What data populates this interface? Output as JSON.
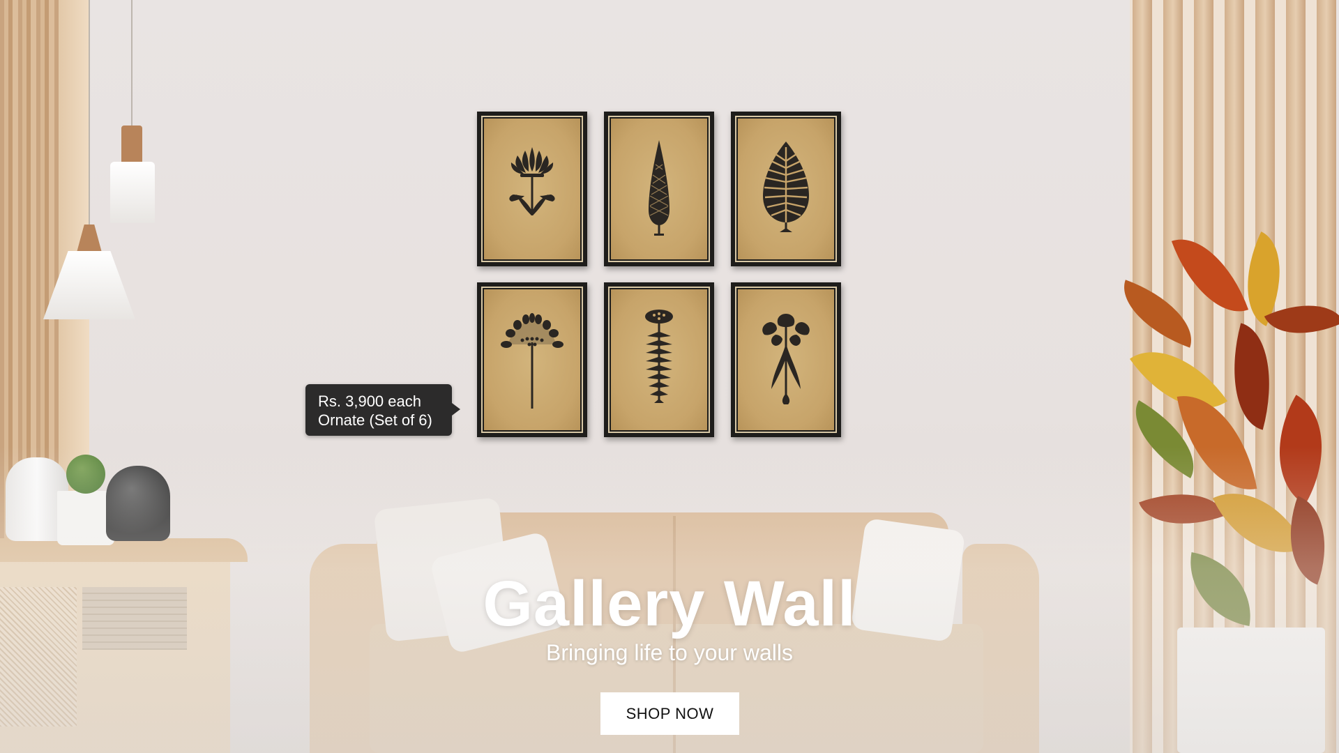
{
  "hero": {
    "title": "Gallery Wall",
    "subtitle": "Bringing life to your walls",
    "cta_label": "SHOP NOW"
  },
  "product_tooltip": {
    "price": "Rs. 3,900 each",
    "name": "Ornate (Set of 6)"
  },
  "gallery": {
    "frames": [
      {
        "motif": "lotus-flower-icon"
      },
      {
        "motif": "cypress-cone-icon"
      },
      {
        "motif": "fern-leaf-icon"
      },
      {
        "motif": "allium-umbel-icon"
      },
      {
        "motif": "fern-stalk-icon"
      },
      {
        "motif": "carnation-cluster-icon"
      }
    ]
  },
  "colors": {
    "wall": "#e9e4e3",
    "frame": "#1e1d1b",
    "art_paper": "#c7a46a",
    "tooltip_bg": "#2c2b2b",
    "button_bg": "#ffffff"
  }
}
